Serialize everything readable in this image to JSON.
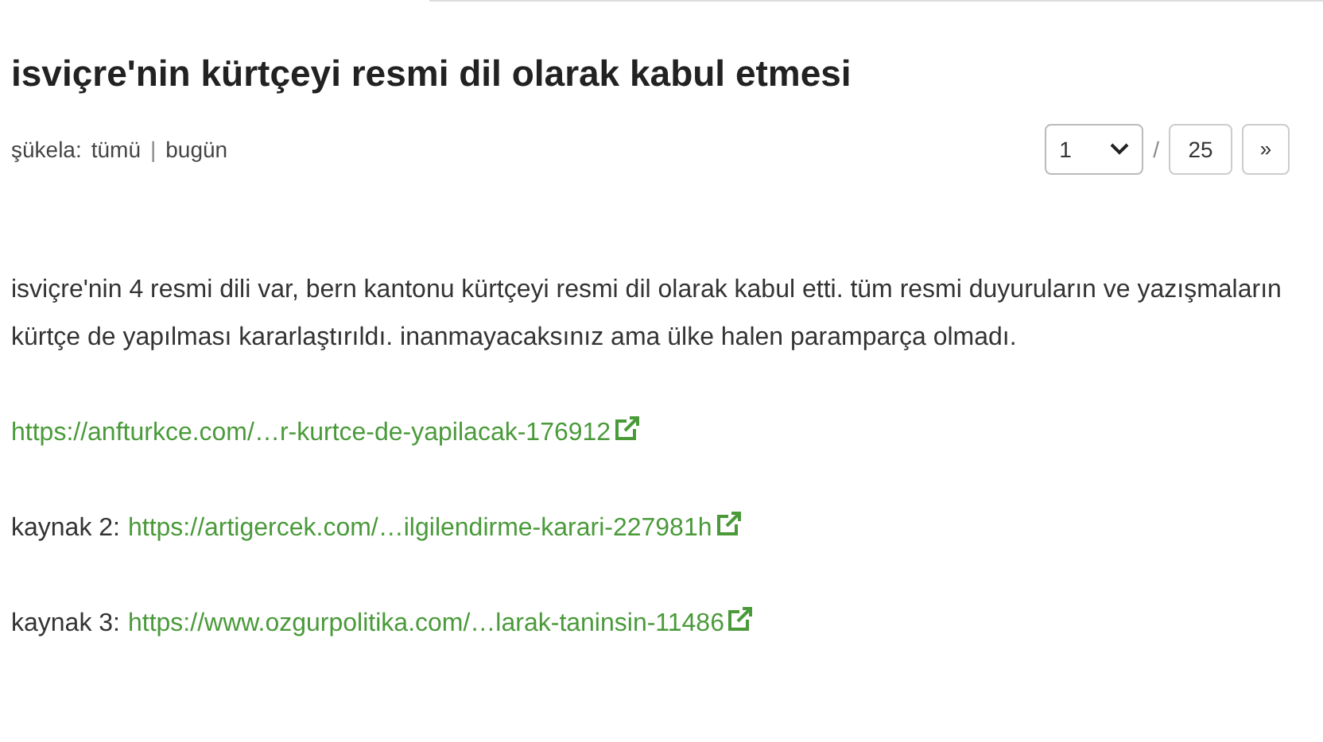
{
  "title": "isviçre'nin kürtçeyi resmi dil olarak kabul etmesi",
  "meta": {
    "label": "şükela:",
    "links": [
      "tümü",
      "bugün"
    ],
    "divider": "|"
  },
  "pager": {
    "page": "1",
    "separator": "/",
    "total": "25",
    "next": "»"
  },
  "body": "isviçre'nin 4 resmi dili var, bern kantonu kürtçeyi resmi dil olarak kabul etti. tüm resmi duyuruların ve yazışmaların kürtçe de yapılması kararlaştırıldı. inanmayacaksınız ama ülke halen paramparça olmadı.",
  "sources": [
    {
      "url": "https://anfturkce.com/…r-kurtce-de-yapilacak-176912"
    },
    {
      "prefix": "kaynak 2:",
      "url": "https://artigercek.com/…ilgilendirme-karari-227981h"
    },
    {
      "prefix": "kaynak 3:",
      "url": "https://www.ozgurpolitika.com/…larak-taninsin-11486"
    }
  ]
}
